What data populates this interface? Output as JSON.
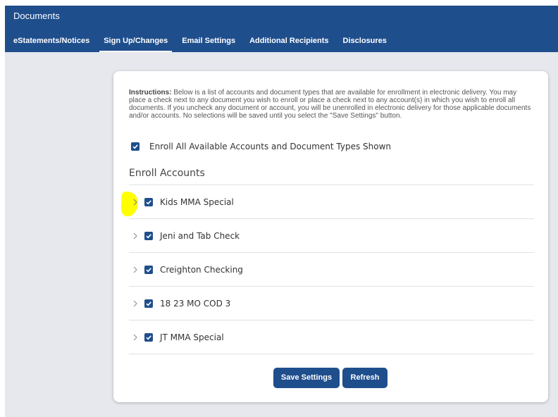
{
  "header": {
    "title": "Documents",
    "tabs": [
      {
        "label": "eStatements/Notices",
        "active": false
      },
      {
        "label": "Sign Up/Changes",
        "active": true
      },
      {
        "label": "Email Settings",
        "active": false
      },
      {
        "label": "Additional Recipients",
        "active": false
      },
      {
        "label": "Disclosures",
        "active": false
      }
    ]
  },
  "instructions": {
    "lead": "Instructions:",
    "text": " Below is a list of accounts and document types that are available for enrollment in electronic delivery. You may place a check next to any document you wish to enroll or place a check next to any account(s) in which you wish to enroll all documents. If you uncheck any document or account, you will be unenrolled in electronic delivery for those applicable documents and/or accounts. No selections will be saved until you select the \"Save Settings\" button."
  },
  "enroll_all": {
    "label": "Enroll All Available Accounts and Document Types Shown",
    "checked": true
  },
  "section_title": "Enroll Accounts",
  "accounts": [
    {
      "label": "Kids MMA Special",
      "checked": true
    },
    {
      "label": "Jeni and Tab Check",
      "checked": true
    },
    {
      "label": "Creighton Checking",
      "checked": true
    },
    {
      "label": "18 23 MO COD 3",
      "checked": true
    },
    {
      "label": "JT MMA Special",
      "checked": true
    }
  ],
  "buttons": {
    "save": "Save Settings",
    "refresh": "Refresh"
  },
  "colors": {
    "primary": "#1f4e8c",
    "background": "#e6e8ee",
    "highlight": "#ffff00"
  },
  "icons": {
    "expand": "chevron-right-icon",
    "check": "checkmark-icon"
  }
}
